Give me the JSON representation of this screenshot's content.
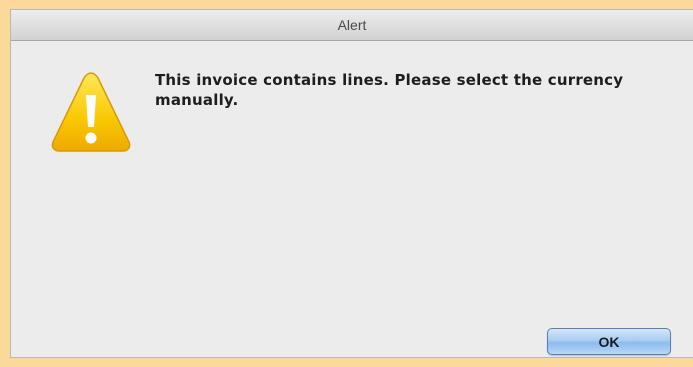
{
  "window": {
    "title": "Alert"
  },
  "alert": {
    "message": "This invoice contains lines. Please select the currency manually.",
    "icon": "warning-icon"
  },
  "buttons": {
    "ok_label": "OK"
  },
  "colors": {
    "backdrop": "#fbd99a",
    "dialog_bg": "#ececec",
    "icon_fill": "#f7c200",
    "button_accent": "#8cbcee"
  }
}
